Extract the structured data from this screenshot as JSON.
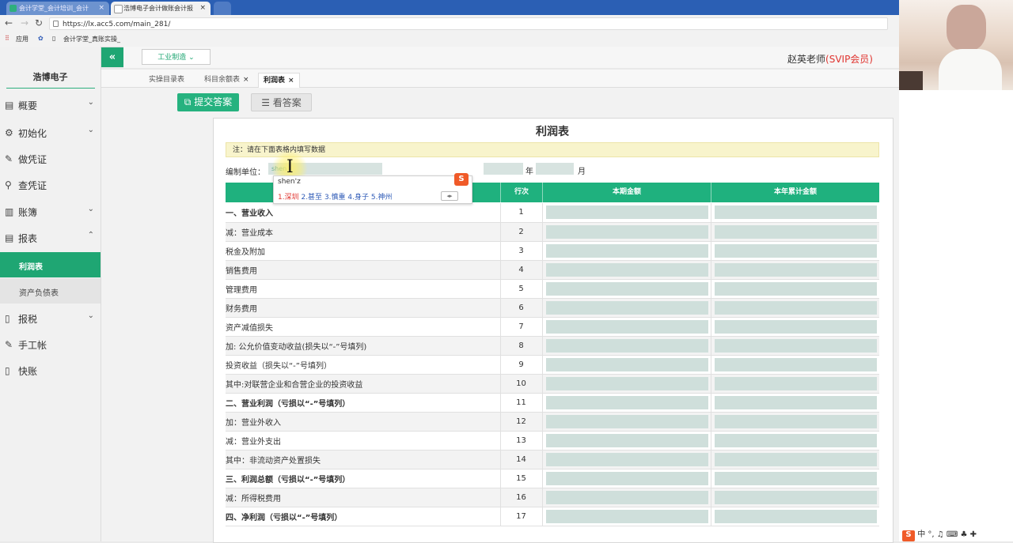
{
  "browser": {
    "tabs": [
      {
        "title": "会计学堂_会计培训_会计"
      },
      {
        "title": "浩博电子会计做账会计报"
      }
    ],
    "url": "https://lx.acc5.com/main_281/",
    "bookmarks": {
      "apps": "应用",
      "item": "会计学堂_真账实操_"
    }
  },
  "sidebar": {
    "company": "浩博电子",
    "items": [
      {
        "label": "概要",
        "icon": "dashboard-icon"
      },
      {
        "label": "初始化",
        "icon": "gear-icon"
      },
      {
        "label": "做凭证",
        "icon": "pen-icon"
      },
      {
        "label": "查凭证",
        "icon": "search-icon"
      },
      {
        "label": "账簿",
        "icon": "book-icon"
      },
      {
        "label": "报表",
        "icon": "report-icon"
      }
    ],
    "report_sub": [
      {
        "label": "利润表"
      },
      {
        "label": "资产负债表"
      }
    ],
    "items2": [
      {
        "label": "报税",
        "icon": "file-icon"
      },
      {
        "label": "手工帐",
        "icon": "pen-icon"
      },
      {
        "label": "快账",
        "icon": "file-icon"
      }
    ]
  },
  "header": {
    "collapse": "«",
    "industry": "工业制造",
    "user_name": "赵英老师",
    "user_vip": "(SVIP会员)"
  },
  "page_tabs": [
    {
      "label": "实操目录表"
    },
    {
      "label": "科目余额表"
    },
    {
      "label": "利润表"
    }
  ],
  "actions": {
    "submit": "提交答案",
    "view": "看答案"
  },
  "report": {
    "title": "利润表",
    "notice": "注：请在下面表格内填写数据",
    "unit_label": "编制单位：",
    "unit_value": "shen",
    "year_label": "年",
    "month_label": "月",
    "columns": [
      "",
      "行次",
      "本期金额",
      "本年累计金额"
    ],
    "rows": [
      {
        "name": "一、营业收入",
        "num": "1",
        "level": 0
      },
      {
        "name": "减：营业成本",
        "num": "2",
        "level": 1
      },
      {
        "name": "税金及附加",
        "num": "3",
        "level": 1
      },
      {
        "name": "销售费用",
        "num": "4",
        "level": 1
      },
      {
        "name": "管理费用",
        "num": "5",
        "level": 1
      },
      {
        "name": "财务费用",
        "num": "6",
        "level": 1
      },
      {
        "name": "资产减值损失",
        "num": "7",
        "level": 1
      },
      {
        "name": "加: 公允价值变动收益(损失以“-”号填列)",
        "num": "8",
        "level": 2
      },
      {
        "name": "投资收益（损失以“-”号填列）",
        "num": "9",
        "level": 1
      },
      {
        "name": "其中:对联营企业和合营企业的投资收益",
        "num": "10",
        "level": 1
      },
      {
        "name": "二、营业利润（亏损以“-”号填列）",
        "num": "11",
        "level": 0
      },
      {
        "name": "加：营业外收入",
        "num": "12",
        "level": 1
      },
      {
        "name": "减：营业外支出",
        "num": "13",
        "level": 1
      },
      {
        "name": "其中：非流动资产处置损失",
        "num": "14",
        "level": 1
      },
      {
        "name": "三、利润总额（亏损以“-”号填列）",
        "num": "15",
        "level": 0
      },
      {
        "name": "减：所得税费用",
        "num": "16",
        "level": 1
      },
      {
        "name": "四、净利润（亏损以“-”号填列）",
        "num": "17",
        "level": 0
      }
    ]
  },
  "ime": {
    "pinyin": "shen'z",
    "candidates": [
      "1.深圳",
      "2.甚至",
      "3.慎重",
      "4.身子",
      "5.神州"
    ],
    "logo": "S"
  },
  "taskbar": {
    "text": "中 °, ♫ ⌨ ♣ ✚"
  }
}
